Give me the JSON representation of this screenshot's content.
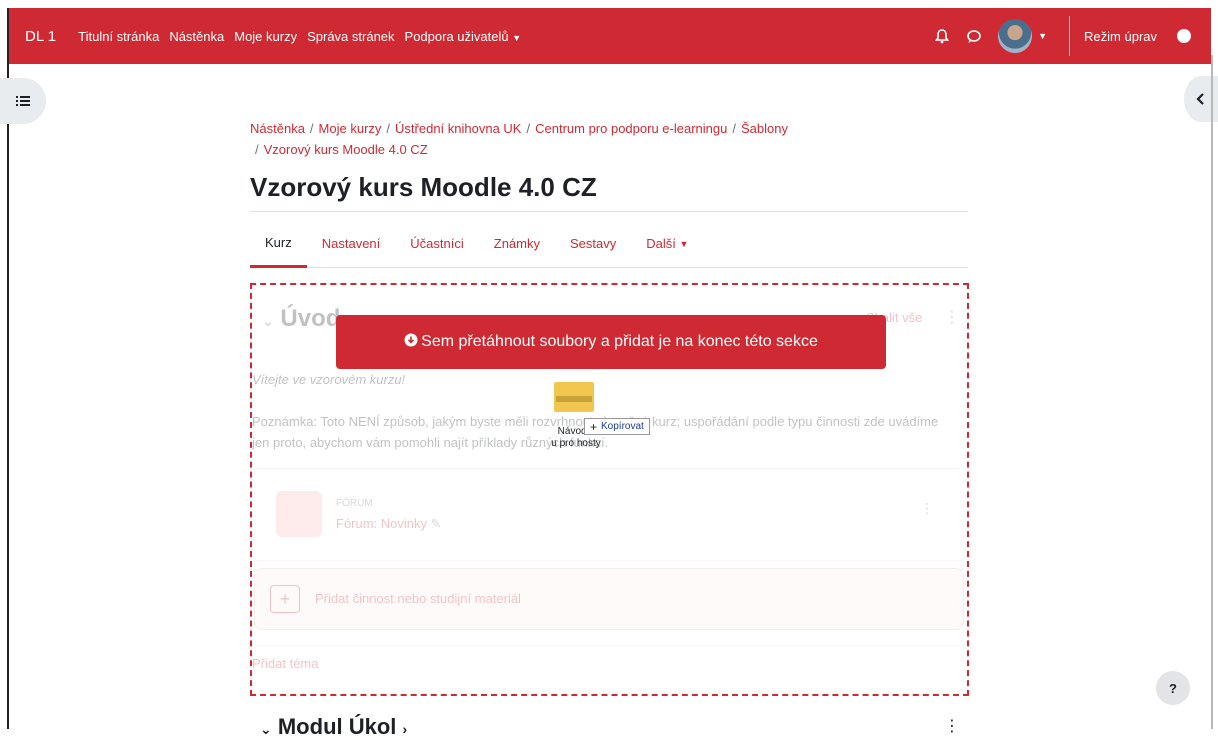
{
  "navbar": {
    "brand": "DL 1",
    "links": [
      "Titulní stránka",
      "Nástěnka",
      "Moje kurzy",
      "Správa stránek",
      "Podpora uživatelů"
    ],
    "edit_mode_label": "Režim úprav"
  },
  "breadcrumb": [
    "Nástěnka",
    "Moje kurzy",
    "Ústřední knihovna UK",
    "Centrum pro podporu e-learningu",
    "Šablony",
    "Vzorový kurs Moodle 4.0 CZ"
  ],
  "page_title": "Vzorový kurs Moodle 4.0 CZ",
  "tabs": [
    "Kurz",
    "Nastavení",
    "Účastníci",
    "Známky",
    "Sestavy",
    "Další"
  ],
  "section": {
    "title": "Úvod",
    "collapse_all": "Sbalit vše",
    "welcome": "Vítejte ve vzorovém kurzu!",
    "note": "Poznámka: Toto NENÍ způsob, jakým byste měli rozvrhnout skutečný kurz; uspořádání podle typu činnosti zde uvádíme jen proto, abychom vám pomohli najít příklady různých funkcí.",
    "forum_type": "FÓRUM",
    "forum_name": "Fórum: Novinky",
    "add_activity": "Přidat činnost nebo studijní materiál",
    "add_topic": "Přidat téma"
  },
  "drop_banner": "Sem přetáhnout soubory a přidat je na konec této sekce",
  "drag": {
    "file_name_1": "Návod k",
    "file_name_2": "u pro hosty",
    "copy_label": "Kopírovat"
  },
  "next_section_title": "Modul Úkol",
  "help_label": "?"
}
